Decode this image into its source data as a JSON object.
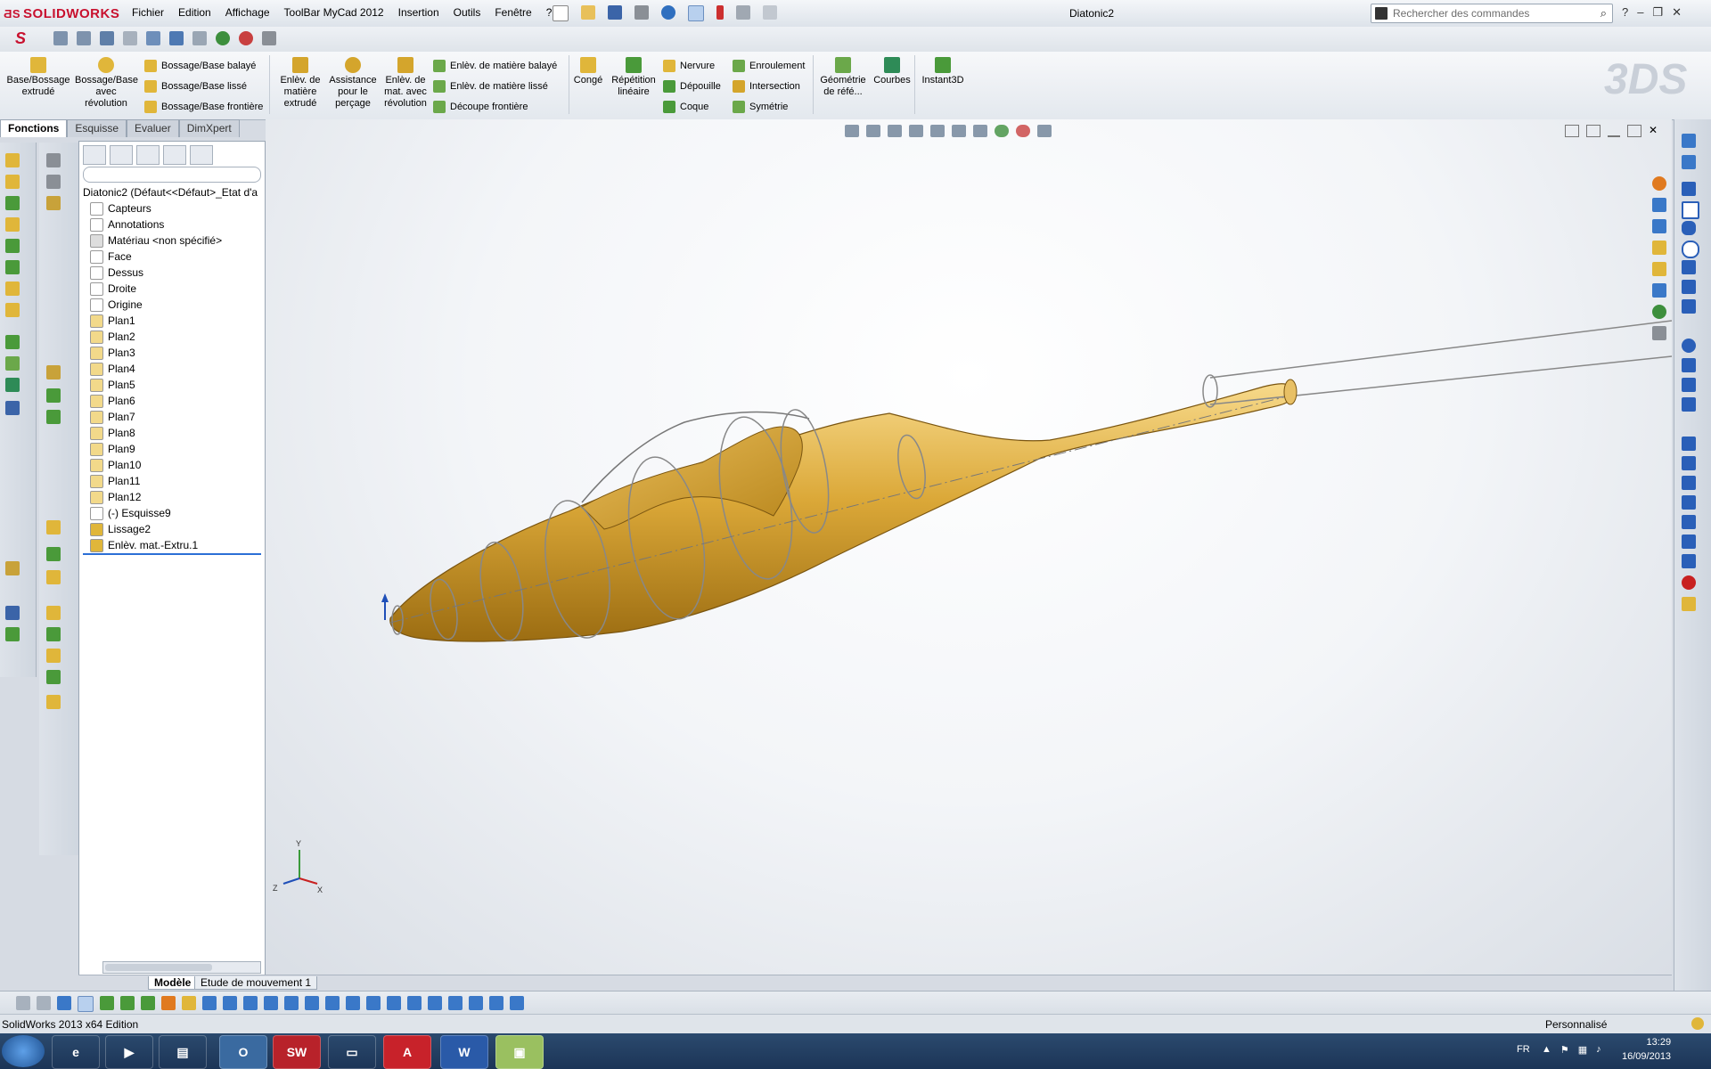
{
  "app": {
    "name": "SOLIDWORKS",
    "document_title": "Diatonic2"
  },
  "menu": [
    "Fichier",
    "Edition",
    "Affichage",
    "ToolBar MyCad 2012",
    "Insertion",
    "Outils",
    "Fenêtre",
    "?"
  ],
  "search": {
    "placeholder": "Rechercher des commandes"
  },
  "ribbon": {
    "base_extrude": "Base/Bossage extrudé",
    "base_revolve": "Bossage/Base avec révolution",
    "swept_boss": "Bossage/Base balayé",
    "lofted_boss": "Bossage/Base lissé",
    "boundary_boss": "Bossage/Base frontière",
    "extruded_cut": "Enlèv. de matière extrudé",
    "hole_wizard": "Assistance pour le perçage",
    "revolved_cut": "Enlèv. de mat. avec révolution",
    "swept_cut": "Enlèv. de matière balayé",
    "lofted_cut": "Enlèv. de matière lissé",
    "boundary_cut": "Découpe frontière",
    "fillet": "Congé",
    "linear_pattern": "Répétition linéaire",
    "rib": "Nervure",
    "draft": "Dépouille",
    "shell": "Coque",
    "wrap": "Enroulement",
    "intersect": "Intersection",
    "mirror": "Symétrie",
    "ref_geometry": "Géométrie de réfé...",
    "curves": "Courbes",
    "instant3d": "Instant3D"
  },
  "tabs": [
    "Fonctions",
    "Esquisse",
    "Evaluer",
    "DimXpert"
  ],
  "tree": {
    "root": "Diatonic2  (Défaut<<Défaut>_Etat d'a",
    "items": [
      "Capteurs",
      "Annotations",
      "Matériau <non spécifié>",
      "Face",
      "Dessus",
      "Droite",
      "Origine",
      "Plan1",
      "Plan2",
      "Plan3",
      "Plan4",
      "Plan5",
      "Plan6",
      "Plan7",
      "Plan8",
      "Plan9",
      "Plan10",
      "Plan11",
      "Plan12",
      "(-) Esquisse9",
      "Lissage2",
      "Enlèv. mat.-Extru.1"
    ]
  },
  "triad": {
    "x": "X",
    "y": "Y",
    "z": "Z"
  },
  "bottom_tabs": [
    "Modèle",
    "Etude de mouvement 1"
  ],
  "status": {
    "left": "SolidWorks 2013 x64 Edition",
    "right": "Personnalisé"
  },
  "taskbar": {
    "lang": "FR",
    "time": "13:29",
    "date": "16/09/2013"
  },
  "colors": {
    "model": "#d9a53a",
    "accent": "#c8102e",
    "viewport_bg": "#f3f5f8"
  }
}
